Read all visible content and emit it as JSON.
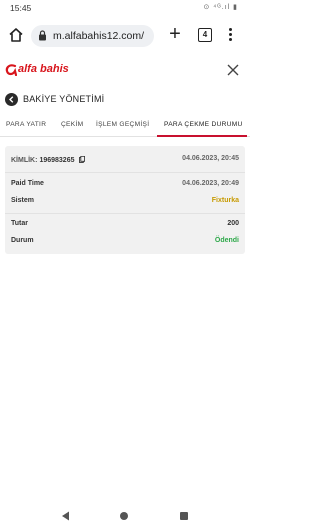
{
  "status": {
    "time": "15:45",
    "icons": "⊙ ⁴ᴳ.ıl ▮"
  },
  "browser": {
    "url": "m.alfabahis12.com/",
    "tab_count": "4",
    "plus": "+"
  },
  "brand": {
    "name": "alfa bahis",
    "accent": "#d8151c"
  },
  "section": {
    "title": "BAKİYE YÖNETİMİ"
  },
  "tabs": [
    {
      "label": "PARA YATIR"
    },
    {
      "label": "ÇEKİM"
    },
    {
      "label": "İŞLEM GEÇMİŞİ"
    },
    {
      "label": "PARA ÇEKME DURUMU",
      "active": true
    }
  ],
  "record": {
    "id_label": "KİMLİK:",
    "id_value": "196983265",
    "date": "04.06.2023, 20:45",
    "paid_time_label": "Paid Time",
    "paid_time_value": "04.06.2023, 20:49",
    "system_label": "Sistem",
    "system_value": "Fixturka",
    "amount_label": "Tutar",
    "amount_value": "200",
    "status_label": "Durum",
    "status_value": "Ödendi"
  },
  "colors": {
    "status_paid": "#2ea84a",
    "system_value": "#c79a00",
    "tab_active_underline": "#c8102e"
  }
}
